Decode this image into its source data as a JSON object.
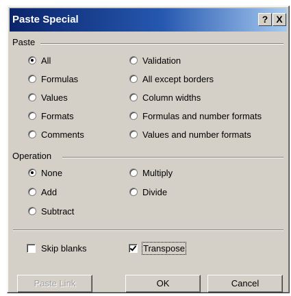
{
  "window": {
    "title": "Paste Special",
    "help_glyph": "?",
    "close_glyph": "X"
  },
  "paste": {
    "label": "Paste",
    "options": [
      "All",
      "Formulas",
      "Values",
      "Formats",
      "Comments",
      "Validation",
      "All except borders",
      "Column widths",
      "Formulas and number formats",
      "Values and number formats"
    ],
    "selected": "All"
  },
  "operation": {
    "label": "Operation",
    "options": [
      "None",
      "Add",
      "Subtract",
      "Multiply",
      "Divide"
    ],
    "selected": "None"
  },
  "skip_blanks": {
    "label": "Skip blanks",
    "checked": false
  },
  "transpose": {
    "label": "Transpose",
    "checked": true
  },
  "buttons": {
    "paste_link": "Paste Link",
    "ok": "OK",
    "cancel": "Cancel"
  }
}
